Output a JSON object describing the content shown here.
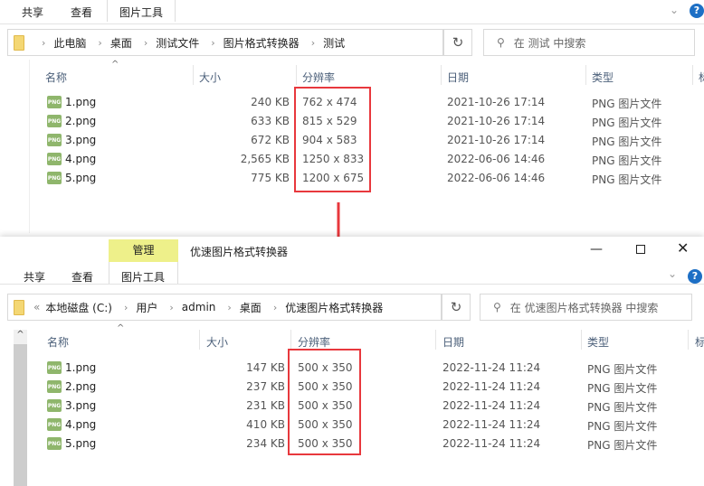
{
  "top_window": {
    "ribbon_tabs": [
      "共享",
      "查看",
      "图片工具"
    ],
    "breadcrumb": [
      "此电脑",
      "桌面",
      "测试文件",
      "图片格式转换器",
      "测试"
    ],
    "search_placeholder": "在 测试 中搜索",
    "columns": [
      "名称",
      "大小",
      "分辨率",
      "日期",
      "类型",
      "标"
    ],
    "files": [
      {
        "name": "1.png",
        "size": "240 KB",
        "resolution": "762 x 474",
        "date": "2021-10-26 17:14",
        "type": "PNG 图片文件"
      },
      {
        "name": "2.png",
        "size": "633 KB",
        "resolution": "815 x 529",
        "date": "2021-10-26 17:14",
        "type": "PNG 图片文件"
      },
      {
        "name": "3.png",
        "size": "672 KB",
        "resolution": "904 x 583",
        "date": "2021-10-26 17:14",
        "type": "PNG 图片文件"
      },
      {
        "name": "4.png",
        "size": "2,565 KB",
        "resolution": "1250 x 833",
        "date": "2022-06-06 14:46",
        "type": "PNG 图片文件"
      },
      {
        "name": "5.png",
        "size": "775 KB",
        "resolution": "1200 x 675",
        "date": "2022-06-06 14:46",
        "type": "PNG 图片文件"
      }
    ]
  },
  "bottom_window": {
    "context_tab": "管理",
    "title": "优速图片格式转换器",
    "ribbon_tabs": [
      "共享",
      "查看",
      "图片工具"
    ],
    "breadcrumb_overflow": "«",
    "breadcrumb": [
      "本地磁盘 (C:)",
      "用户",
      "admin",
      "桌面",
      "优速图片格式转换器"
    ],
    "search_placeholder": "在 优速图片格式转换器 中搜索",
    "columns": [
      "名称",
      "大小",
      "分辨率",
      "日期",
      "类型",
      "标"
    ],
    "files": [
      {
        "name": "1.png",
        "size": "147 KB",
        "resolution": "500 x 350",
        "date": "2022-11-24 11:24",
        "type": "PNG 图片文件"
      },
      {
        "name": "2.png",
        "size": "237 KB",
        "resolution": "500 x 350",
        "date": "2022-11-24 11:24",
        "type": "PNG 图片文件"
      },
      {
        "name": "3.png",
        "size": "231 KB",
        "resolution": "500 x 350",
        "date": "2022-11-24 11:24",
        "type": "PNG 图片文件"
      },
      {
        "name": "4.png",
        "size": "410 KB",
        "resolution": "500 x 350",
        "date": "2022-11-24 11:24",
        "type": "PNG 图片文件"
      },
      {
        "name": "5.png",
        "size": "234 KB",
        "resolution": "500 x 350",
        "date": "2022-11-24 11:24",
        "type": "PNG 图片文件"
      }
    ]
  },
  "icon_label": "PNG",
  "colors": {
    "highlight": "#e8383d",
    "context_tab": "#eef08a"
  }
}
